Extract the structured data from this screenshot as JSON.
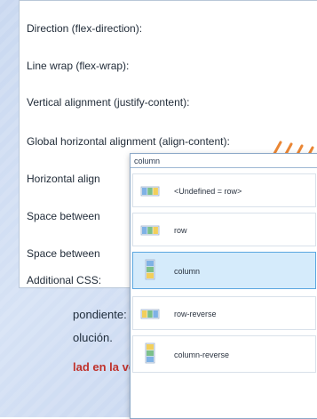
{
  "panel": {
    "properties": [
      "Direction (flex-direction):",
      "Line wrap (flex-wrap):",
      "Vertical alignment (justify-content):",
      "Global horizontal alignment (align-content):",
      "Horizontal align",
      "Space between",
      "Space between",
      "Additional CSS:"
    ]
  },
  "page_text": {
    "o_fragment": "o",
    "line1": "pondiente:",
    "line2": "olución.",
    "line3": "lad en la ver-"
  },
  "dropdown": {
    "current_value": "column",
    "options": [
      {
        "label": "<Undefined = row>",
        "icon": "flex-row-icon"
      },
      {
        "label": "row",
        "icon": "flex-row-icon"
      },
      {
        "label": "column",
        "icon": "flex-column-icon",
        "selected": true
      },
      {
        "label": "row-reverse",
        "icon": "flex-row-reverse-icon"
      },
      {
        "label": "column-reverse",
        "icon": "flex-column-reverse-icon"
      }
    ]
  },
  "colors": {
    "selected_bg": "#d5ebfb",
    "selected_border": "#5ba7e0",
    "accent": "#e87a1f",
    "body_text_red": "#c0322c"
  }
}
